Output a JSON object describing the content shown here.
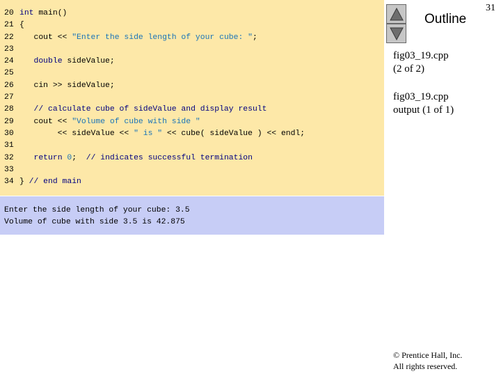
{
  "code": {
    "lines": [
      {
        "num": "20",
        "parts": [
          [
            "kw",
            "int"
          ],
          [
            "t",
            " main()"
          ]
        ]
      },
      {
        "num": "21",
        "parts": [
          [
            "t",
            "{"
          ]
        ]
      },
      {
        "num": "22",
        "parts": [
          [
            "t",
            "   cout << "
          ],
          [
            "str",
            "\"Enter the side length of your cube: \""
          ],
          [
            "t",
            ";"
          ]
        ]
      },
      {
        "num": "23",
        "parts": []
      },
      {
        "num": "24",
        "parts": [
          [
            "t",
            "   "
          ],
          [
            "kw",
            "double"
          ],
          [
            "t",
            " sideValue;"
          ]
        ]
      },
      {
        "num": "25",
        "parts": []
      },
      {
        "num": "26",
        "parts": [
          [
            "t",
            "   cin >> sideValue;"
          ]
        ]
      },
      {
        "num": "27",
        "parts": []
      },
      {
        "num": "28",
        "parts": [
          [
            "t",
            "   "
          ],
          [
            "cm",
            "// calculate cube of sideValue and display result"
          ]
        ]
      },
      {
        "num": "29",
        "parts": [
          [
            "t",
            "   cout << "
          ],
          [
            "str",
            "\"Volume of cube with side \""
          ]
        ]
      },
      {
        "num": "30",
        "parts": [
          [
            "t",
            "        << sideValue << "
          ],
          [
            "str",
            "\" is \""
          ],
          [
            "t",
            " << cube( sideValue ) << endl;"
          ]
        ]
      },
      {
        "num": "31",
        "parts": []
      },
      {
        "num": "32",
        "parts": [
          [
            "t",
            "   "
          ],
          [
            "kw",
            "return"
          ],
          [
            "t",
            " "
          ],
          [
            "str",
            "0"
          ],
          [
            "t",
            ";  "
          ],
          [
            "cm",
            "// indicates successful termination"
          ]
        ]
      },
      {
        "num": "33",
        "parts": []
      },
      {
        "num": "34",
        "parts": [
          [
            "t",
            "} "
          ],
          [
            "cm",
            "// end main"
          ]
        ]
      }
    ]
  },
  "output": {
    "lines": [
      "Enter the side length of your cube: 3.5",
      "Volume of cube with side 3.5 is 42.875"
    ]
  },
  "sidebar": {
    "title": "Outline",
    "page_number": "31",
    "file_label_1": "fig03_19.cpp",
    "file_label_1_sub": "(2 of 2)",
    "file_label_2": "fig03_19.cpp",
    "file_label_2_sub": "output (1 of 1)",
    "copyright_1": "© Prentice Hall, Inc.",
    "copyright_2": "All rights reserved."
  },
  "nav": {
    "up_icon": "up-arrow-icon",
    "down_icon": "down-arrow-icon"
  },
  "colors": {
    "code_background": "#fde8a8",
    "output_background": "#c7cdf6",
    "keyword": "#000080",
    "string": "#1a74b8",
    "comment": "#000080"
  }
}
